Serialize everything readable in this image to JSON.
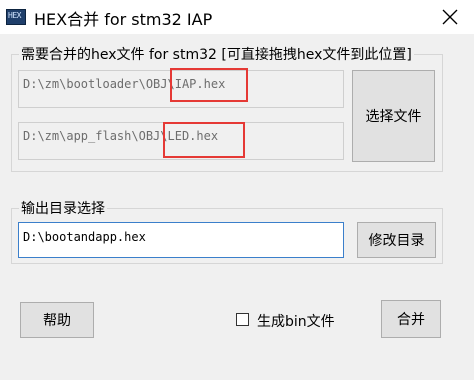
{
  "window": {
    "icon_text": "HEX",
    "title": "HEX合并 for stm32 IAP",
    "close_icon": "close-icon"
  },
  "input_group": {
    "label": "需要合并的hex文件 for stm32 [可直接拖拽hex文件到此位置]",
    "path1": "D:\\zm\\bootloader\\OBJ\\IAP.hex",
    "path2": "D:\\zm\\app_flash\\OBJ\\LED.hex",
    "select_button": "选择文件"
  },
  "output_group": {
    "label": "输出目录选择",
    "path": "D:\\bootandapp.hex",
    "modify_button": "修改目录"
  },
  "bottom": {
    "help_button": "帮助",
    "bin_checkbox_label": "生成bin文件",
    "bin_checked": false,
    "merge_button": "合并"
  },
  "colors": {
    "highlight": "#e53935",
    "focus_border": "#3b7fcb"
  }
}
